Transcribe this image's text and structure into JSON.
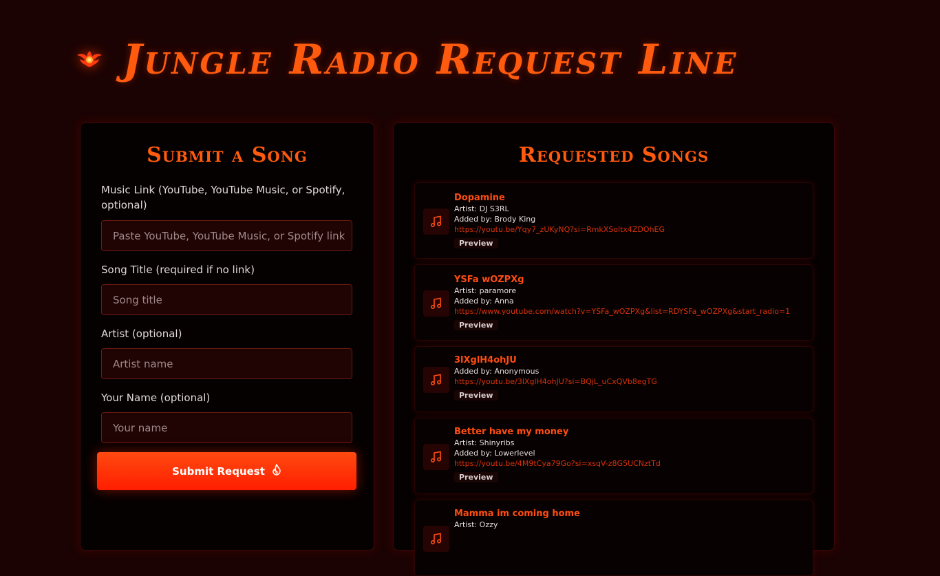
{
  "header": {
    "title": "Jungle Radio Request Line",
    "logo_icon": "glowing-emblem-icon"
  },
  "colors": {
    "background": "#1c0303",
    "accent": "#ff5a0e",
    "button": "#ff2a00",
    "link": "#d8320c"
  },
  "submit_panel": {
    "title": "Submit a Song",
    "fields": [
      {
        "label": "Music Link (YouTube, YouTube Music, or Spotify, optional)",
        "placeholder": "Paste YouTube, YouTube Music, or Spotify link",
        "value": ""
      },
      {
        "label": "Song Title (required if no link)",
        "placeholder": "Song title",
        "value": ""
      },
      {
        "label": "Artist (optional)",
        "placeholder": "Artist name",
        "value": ""
      },
      {
        "label": "Your Name (optional)",
        "placeholder": "Your name",
        "value": ""
      }
    ],
    "submit_label": "Submit Request",
    "submit_icon": "flame-icon"
  },
  "requests_panel": {
    "title": "Requested Songs",
    "songs": [
      {
        "title": "Dopamine",
        "artist": "Artist: DJ S3RL",
        "added_by": "Added by: Brody King",
        "link": "https://youtu.be/Yqy7_zUKyNQ?si=RmkXSoltx4ZDOhEG",
        "preview": "Preview"
      },
      {
        "title": "YSFa wOZPXg",
        "artist": "Artist: paramore",
        "added_by": "Added by: Anna",
        "link": "https://www.youtube.com/watch?v=YSFa_wOZPXg&list=RDYSFa_wOZPXg&start_radio=1",
        "preview": "Preview"
      },
      {
        "title": "3lXglH4ohJU",
        "artist": "",
        "added_by": "Added by: Anonymous",
        "link": "https://youtu.be/3lXglH4ohJU?si=BQjL_uCxQVb8egTG",
        "preview": "Preview"
      },
      {
        "title": "Better have my money",
        "artist": "Artist: Shinyribs",
        "added_by": "Added by: Lowerlevel",
        "link": "https://youtu.be/4M9tCya79Go?si=xsqV-z8G5UCNztTd",
        "preview": "Preview"
      },
      {
        "title": "Mamma im coming home",
        "artist": "Artist: Ozzy",
        "added_by": "",
        "link": "",
        "preview": ""
      }
    ]
  }
}
